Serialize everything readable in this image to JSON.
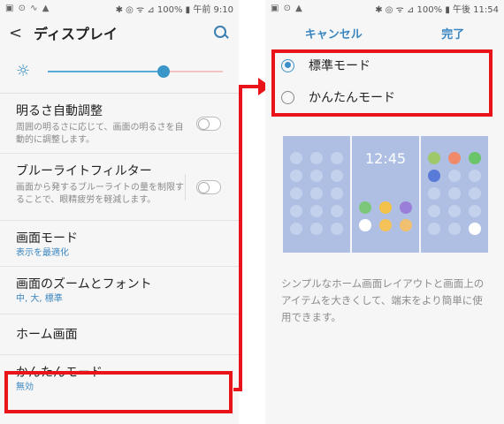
{
  "left": {
    "status": {
      "icons": "▣ ⊙ ∿ ▲",
      "right": "✱ ◎ ᯤ ⊿ 100% ▮ 午前 9:10"
    },
    "title": "ディスプレイ",
    "brightness_level": 0.66,
    "items": [
      {
        "title": "明るさ自動調整",
        "desc": "周囲の明るさに応じて、画面の明るさを自動的に調整します。"
      },
      {
        "title": "ブルーライトフィルター",
        "desc": "画面から発するブルーライトの量を制限することで、眼精疲労を軽減します。"
      },
      {
        "title": "画面モード",
        "sub": "表示を最適化"
      },
      {
        "title": "画面のズームとフォント",
        "sub": "中, 大, 標準"
      },
      {
        "title": "ホーム画面"
      },
      {
        "title": "かんたんモード",
        "sub": "無効"
      }
    ]
  },
  "right": {
    "status": {
      "icons": "▣ ⊙ ▲",
      "right": "✱ ◎ ᯤ ⊿ 100% ▮ 午後 11:54"
    },
    "cancel": "キャンセル",
    "done": "完了",
    "options": [
      "標準モード",
      "かんたんモード"
    ],
    "selected": 0,
    "clock": "12:45",
    "description": "シンプルなホーム画面レイアウトと画面上のアイテムを大きくして、端末をより簡単に使用できます。"
  },
  "colors": {
    "accent": "#3a86c0",
    "highlight": "#e8141a"
  }
}
